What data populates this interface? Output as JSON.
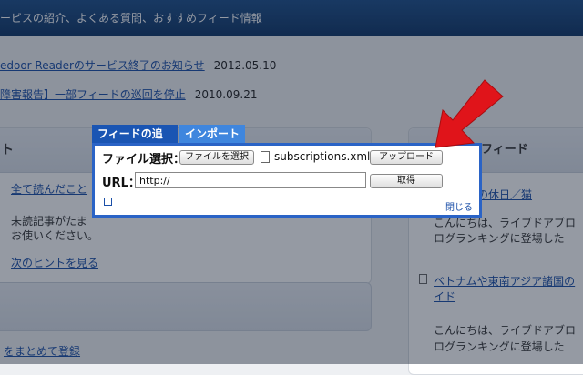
{
  "header": {
    "text": "ービスの紹介、よくある質問、おすすめフィード情報"
  },
  "news": [
    {
      "title": "edoor Readerのサービス終了のお知らせ",
      "date": "2012.05.10"
    },
    {
      "title": "障害報告】一部フィードの巡回を停止",
      "date": "2010.09.21"
    }
  ],
  "left_panel": {
    "title": "ト",
    "link1": "全て読んだこと",
    "text1": "未読記事がたま",
    "text2": "お使いください。",
    "link2": "次のヒントを見る",
    "link3": "をまとめて登録"
  },
  "right_panel": {
    "title": "すすめフィード",
    "item1_link": "日・伊豆の休日／猫",
    "item1_text1": "こんにちは、ライブドアブロ",
    "item1_text2": "ログランキングに登場した",
    "item2_link_line1": "ベトナムや東南アジア諸国の",
    "item2_link_line2": "イド",
    "item2_text1": "こんにちは、ライブドアブロ",
    "item2_text2": "ログランキングに登場した"
  },
  "dialog": {
    "tab_add": "フィードの追加",
    "tab_import": "インポート",
    "file_label": "ファイル選択：",
    "choose_button": "ファイルを選択",
    "file_name": "subscriptions.xml",
    "upload_button": "アップロード",
    "url_label": "URL：",
    "url_value": "http://",
    "fetch_button": "取得",
    "close_link": "閉じる"
  },
  "colors": {
    "header": "#0f3566",
    "dialog_border": "#2a63c6",
    "tab_active": "#1a55b3",
    "tab": "#3f86de",
    "arrow": "#e0141a"
  },
  "icons": [
    "file-icon",
    "expand-icon",
    "arrow-icon",
    "feed-icon"
  ]
}
